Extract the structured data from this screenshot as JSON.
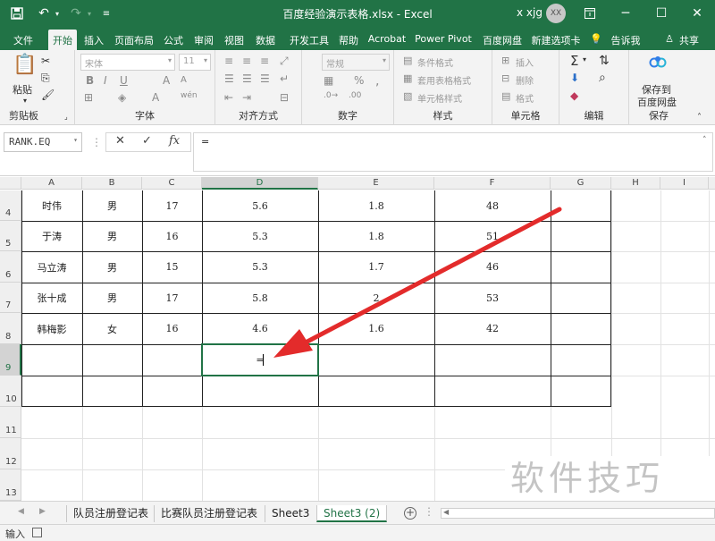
{
  "titlebar": {
    "title": "百度经验演示表格.xlsx  -  Excel",
    "user": "x xjg",
    "avatar_initials": "XX",
    "bg_color": "#217346"
  },
  "tabs": [
    "文件",
    "开始",
    "插入",
    "页面布局",
    "公式",
    "审阅",
    "视图",
    "数据",
    "开发工具",
    "帮助",
    "Acrobat",
    "Power Pivot",
    "百度网盘",
    "新建选项卡",
    "告诉我",
    "共享"
  ],
  "ribbon": {
    "groups": [
      "剪贴板",
      "字体",
      "对齐方式",
      "数字",
      "样式",
      "单元格",
      "编辑",
      "保存"
    ],
    "paste": "粘贴",
    "font_name": "宋体",
    "font_size": "11",
    "number_format": "常规",
    "percent": "%",
    "styles": [
      "条件格式",
      "套用表格格式",
      "单元格样式"
    ],
    "cells": [
      "插入",
      "删除",
      "格式"
    ],
    "save_to": [
      "保存到",
      "百度网盘"
    ]
  },
  "formula_bar": {
    "name_box": "RANK.EQ",
    "fx": "fx",
    "content": "="
  },
  "columns": [
    "A",
    "B",
    "C",
    "D",
    "E",
    "F",
    "G",
    "H",
    "I"
  ],
  "rows": [
    "4",
    "5",
    "6",
    "7",
    "8",
    "9",
    "10",
    "11",
    "12",
    "13"
  ],
  "table_rows": [
    [
      "时伟",
      "男",
      "17",
      "5.6",
      "1.8",
      "48"
    ],
    [
      "于涛",
      "男",
      "16",
      "5.3",
      "1.8",
      "51"
    ],
    [
      "马立涛",
      "男",
      "15",
      "5.3",
      "1.7",
      "46"
    ],
    [
      "张十成",
      "男",
      "17",
      "5.8",
      "2",
      "53"
    ],
    [
      "韩梅影",
      "女",
      "16",
      "4.6",
      "1.6",
      "42"
    ],
    [
      "",
      "",
      "",
      "=",
      "",
      ""
    ],
    [
      "",
      "",
      "",
      "",
      "",
      ""
    ]
  ],
  "sheets": [
    "队员注册登记表",
    "比赛队员注册登记表",
    "Sheet3",
    "Sheet3 (2)"
  ],
  "active_sheet": "Sheet3 (2)",
  "status": "输入",
  "watermark": "软件技巧",
  "arrow_color": "#e32b2b"
}
